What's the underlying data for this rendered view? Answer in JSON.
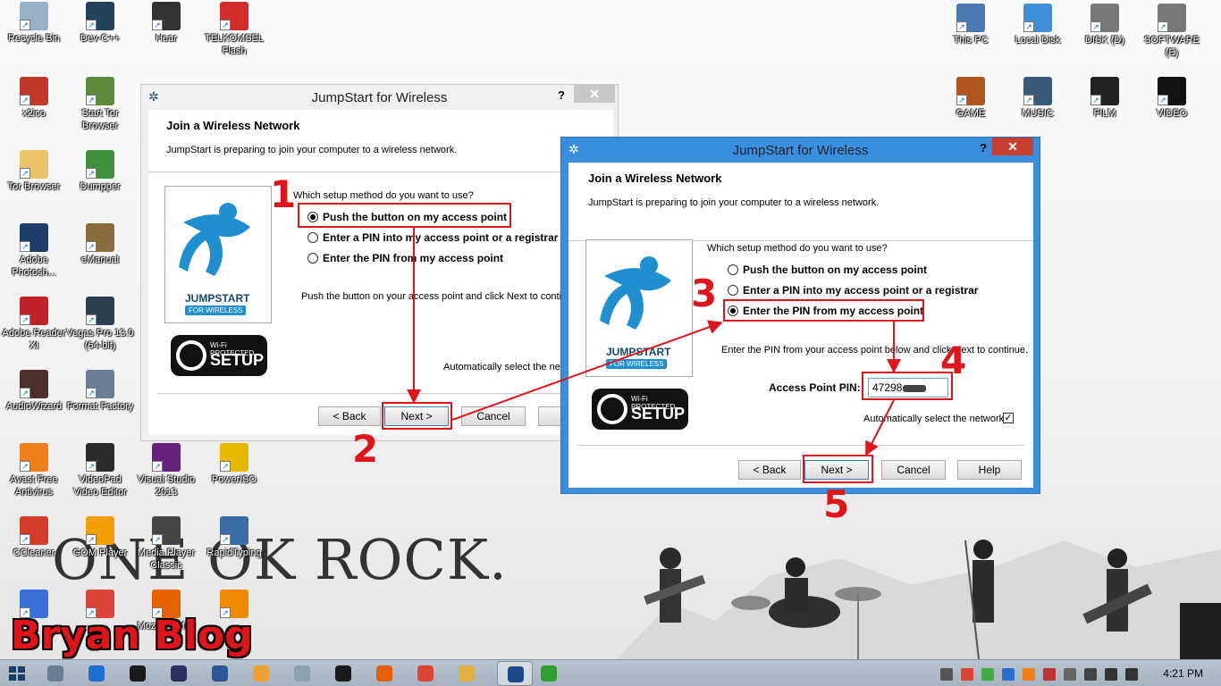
{
  "desktop_icons": [
    {
      "label": "Recycle Bin",
      "icon": "recycle-bin-icon",
      "color": "#9ab0c8"
    },
    {
      "label": "Dev-C++",
      "icon": "devcpp-icon",
      "color": "#24425e"
    },
    {
      "label": "Hear",
      "icon": "headphones-icon",
      "color": "#333333"
    },
    {
      "label": "TELKOMSEL Flash",
      "icon": "telkomsel-icon",
      "color": "#d42b2b"
    },
    {
      "label": "x2ico",
      "icon": "x2ico-icon",
      "color": "#c0392b"
    },
    {
      "label": "Start Tor Browser",
      "icon": "tor-globe-icon",
      "color": "#5c8a3a"
    },
    {
      "label": "Tor Browser",
      "icon": "folder-icon",
      "color": "#e9c46a"
    },
    {
      "label": "Dumpper",
      "icon": "wifi-shield-icon",
      "color": "#3f8f3f"
    },
    {
      "label": "Adobe Photosh...",
      "icon": "photoshop-icon",
      "color": "#1f3d6b"
    },
    {
      "label": "eManual",
      "icon": "emanual-icon",
      "color": "#8a6d3b"
    },
    {
      "label": "Adobe Reader XI",
      "icon": "adobe-reader-icon",
      "color": "#c0222c"
    },
    {
      "label": "Vegas Pro 13.0 (64-bit)",
      "icon": "vegas-icon",
      "color": "#2c3e50"
    },
    {
      "label": "AudioWizard",
      "icon": "audiowizard-icon",
      "color": "#4a2f2a"
    },
    {
      "label": "Format Factory",
      "icon": "format-factory-icon",
      "color": "#6a7f95"
    },
    {
      "label": "Avast Free Antivirus",
      "icon": "avast-icon",
      "color": "#f07e1b"
    },
    {
      "label": "VideoPad Video Editor",
      "icon": "videopad-icon",
      "color": "#2b2b2b"
    },
    {
      "label": "Visual Studio 2013",
      "icon": "visual-studio-icon",
      "color": "#68217a"
    },
    {
      "label": "PowerISO",
      "icon": "poweriso-icon",
      "color": "#e6b800"
    },
    {
      "label": "CCleaner",
      "icon": "ccleaner-icon",
      "color": "#d43d2b"
    },
    {
      "label": "GOM Player",
      "icon": "gom-player-icon",
      "color": "#f0a000"
    },
    {
      "label": "Media Player Classic",
      "icon": "media-player-icon",
      "color": "#444444"
    },
    {
      "label": "RapidTyping",
      "icon": "rapidtyping-icon",
      "color": "#3b6ea5"
    },
    {
      "label": "",
      "icon": "generic-app-icon",
      "color": "#3a6fd8"
    },
    {
      "label": "",
      "icon": "chrome-icon",
      "color": "#db4437"
    },
    {
      "label": "Mozill Firefox",
      "icon": "firefox-icon",
      "color": "#e66000"
    },
    {
      "label": "",
      "icon": "vlc-icon",
      "color": "#f08a00"
    },
    {
      "label": "This PC",
      "icon": "this-pc-icon",
      "color": "#4a78b0"
    },
    {
      "label": "Local Disk",
      "icon": "local-disk-icon",
      "color": "#3d8fd8"
    },
    {
      "label": "DISK (D)",
      "icon": "disk-d-icon",
      "color": "#777777"
    },
    {
      "label": "SOFTWARE (E)",
      "icon": "software-e-icon",
      "color": "#777777"
    },
    {
      "label": "GAME",
      "icon": "game-folder-icon",
      "color": "#b0561f"
    },
    {
      "label": "MUSIC",
      "icon": "music-folder-icon",
      "color": "#3b5a7a"
    },
    {
      "label": "FILM",
      "icon": "film-folder-icon",
      "color": "#222222"
    },
    {
      "label": "VIDEO",
      "icon": "video-folder-icon",
      "color": "#111111"
    }
  ],
  "wallpaper": {
    "brand_text": "ONE OK ROCK."
  },
  "dialog_back": {
    "title": "JumpStart for Wireless",
    "help": "?",
    "close": "✕",
    "heading": "Join a Wireless Network",
    "subheading": "JumpStart is preparing to join your computer to a wireless network.",
    "question": "Which setup method do you want to use?",
    "options": [
      "Push the button on my access point",
      "Enter a PIN into my access point or a registrar",
      "Enter the PIN from my access point"
    ],
    "selected_index": 0,
    "instruction": "Push the button on your access point and click Next to contir",
    "auto_select": "Automatically select the net",
    "buttons": {
      "back": "< Back",
      "next": "Next >",
      "cancel": "Cancel"
    }
  },
  "dialog_front": {
    "title": "JumpStart for Wireless",
    "help": "?",
    "close": "✕",
    "heading": "Join a Wireless Network",
    "subheading": "JumpStart is preparing to join your computer to a wireless network.",
    "question": "Which setup method do you want to use?",
    "options": [
      "Push the button on my access point",
      "Enter a PIN into my access point or a registrar",
      "Enter the PIN from my access point"
    ],
    "selected_index": 2,
    "instruction": "Enter the PIN from your access point below and click Next to continue.",
    "pin_label": "Access Point PIN:",
    "pin_value": "47298",
    "auto_select": "Automatically select the network",
    "auto_select_checked": true,
    "buttons": {
      "back": "< Back",
      "next": "Next >",
      "cancel": "Cancel",
      "help": "Help"
    }
  },
  "logo": {
    "jumpstart": "JUMPSTART",
    "for_wireless": "FOR WIRELESS",
    "wps_top": "Wi-Fi PROTECTED",
    "wps_bottom": "SETUP"
  },
  "annotations": {
    "step1": "1",
    "step2": "2",
    "step3": "3",
    "step4": "4",
    "step5": "5",
    "color": "#e0141b"
  },
  "watermark": "Bryan Blog",
  "taskbar": {
    "items": [
      "desktop-icon",
      "ie-icon",
      "obs-icon",
      "target-app-icon",
      "word-icon",
      "media-ball-icon",
      "gallery-icon",
      "cmd-icon",
      "firefox-icon",
      "chrome-icon",
      "paint-icon",
      "jumpstart-icon",
      "wifi-icon"
    ],
    "active_item": "jumpstart-icon",
    "clock": "4:21 PM"
  }
}
